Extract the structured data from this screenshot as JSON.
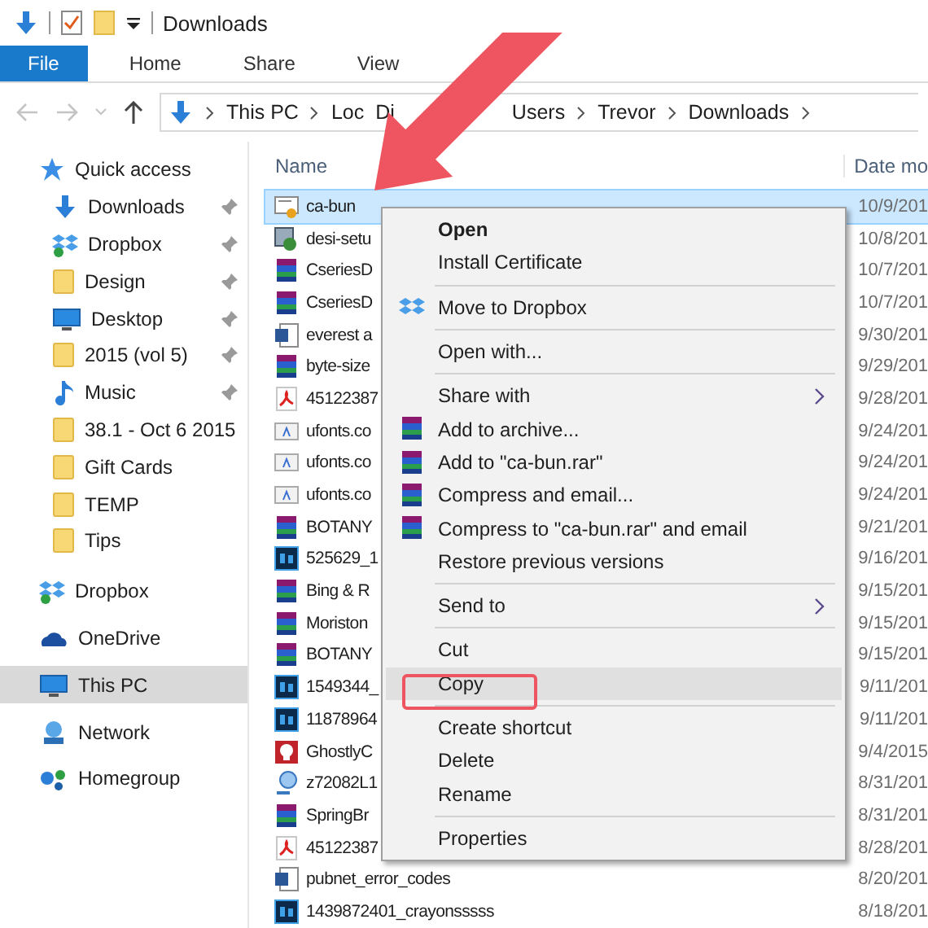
{
  "window": {
    "title": "Downloads"
  },
  "ribbon_tabs": [
    {
      "label": "File",
      "kind": "file",
      "selected": false
    },
    {
      "label": "Home",
      "kind": "tab",
      "selected": false
    },
    {
      "label": "Share",
      "kind": "tab",
      "selected": false
    },
    {
      "label": "View",
      "kind": "tab",
      "selected": false
    }
  ],
  "address": {
    "crumbs": [
      {
        "kind": "crumb",
        "label": "This PC"
      },
      {
        "kind": "partial",
        "parts": [
          "Loc",
          "Di"
        ]
      },
      {
        "kind": "crumb",
        "label": "Users"
      },
      {
        "kind": "crumb",
        "label": "Trevor"
      },
      {
        "kind": "crumb",
        "label": "Downloads"
      }
    ]
  },
  "sidebar": {
    "items": [
      {
        "label": "Quick access",
        "kind": "star",
        "pinned": false,
        "selected": false,
        "children": [
          {
            "label": "Downloads",
            "kind": "download",
            "pinned": true,
            "selected": false
          },
          {
            "label": "Dropbox",
            "kind": "dropbox",
            "pinned": true,
            "selected": false
          },
          {
            "label": "Design",
            "kind": "folder",
            "pinned": true,
            "selected": false
          },
          {
            "label": "Desktop",
            "kind": "desktop",
            "pinned": true,
            "selected": false
          },
          {
            "label": "2015 (vol 5)",
            "kind": "folder",
            "pinned": true,
            "selected": false
          },
          {
            "label": "Music",
            "kind": "music",
            "pinned": true,
            "selected": false
          },
          {
            "label": "38.1 - Oct 6 2015",
            "kind": "folder",
            "pinned": false,
            "selected": false
          },
          {
            "label": "Gift Cards",
            "kind": "folder",
            "pinned": false,
            "selected": false
          },
          {
            "label": "TEMP",
            "kind": "folder",
            "pinned": false,
            "selected": false
          },
          {
            "label": "Tips",
            "kind": "folder",
            "pinned": false,
            "selected": false
          }
        ]
      },
      {
        "label": "Dropbox",
        "kind": "dropbox",
        "pinned": false,
        "selected": false
      },
      {
        "label": "OneDrive",
        "kind": "cloud",
        "pinned": false,
        "selected": false
      },
      {
        "label": "This PC",
        "kind": "desktop",
        "pinned": false,
        "selected": true
      },
      {
        "label": "Network",
        "kind": "network",
        "pinned": false,
        "selected": false
      },
      {
        "label": "Homegroup",
        "kind": "homegroup",
        "pinned": false,
        "selected": false
      }
    ]
  },
  "file_list": {
    "columns": [
      "Name",
      "Date mo"
    ],
    "rows": [
      {
        "name": "ca-bun",
        "date": "10/9/201",
        "kind": "cert",
        "selected": true
      },
      {
        "name": "desi-setu",
        "date": "10/8/201",
        "kind": "setup",
        "selected": false
      },
      {
        "name": "CseriesD",
        "date": "10/7/201",
        "kind": "archive",
        "selected": false
      },
      {
        "name": "CseriesD",
        "date": "10/7/201",
        "kind": "archive",
        "selected": false
      },
      {
        "name": "everest a",
        "date": "9/30/201",
        "kind": "word",
        "selected": false
      },
      {
        "name": "byte-size",
        "date": "9/29/201",
        "kind": "archive",
        "selected": false
      },
      {
        "name": "45122387",
        "date": "9/28/201",
        "kind": "pdf",
        "selected": false
      },
      {
        "name": "ufonts.co",
        "date": "9/24/201",
        "kind": "font",
        "selected": false
      },
      {
        "name": "ufonts.co",
        "date": "9/24/201",
        "kind": "font",
        "selected": false
      },
      {
        "name": "ufonts.co",
        "date": "9/24/201",
        "kind": "font",
        "selected": false
      },
      {
        "name": "BOTANY",
        "date": "9/21/201",
        "kind": "archive",
        "selected": false
      },
      {
        "name": "525629_1",
        "date": "9/16/201",
        "kind": "ps",
        "selected": false
      },
      {
        "name": "Bing & R",
        "date": "9/15/201",
        "kind": "archive",
        "selected": false
      },
      {
        "name": "Moriston",
        "date": "9/15/201",
        "kind": "archive",
        "selected": false
      },
      {
        "name": "BOTANY",
        "date": "9/15/201",
        "kind": "archive",
        "selected": false
      },
      {
        "name": "1549344_",
        "date": "9/11/201",
        "kind": "ps",
        "selected": false
      },
      {
        "name": "11878964",
        "date": "9/11/201",
        "kind": "ps",
        "selected": false
      },
      {
        "name": "GhostlyC",
        "date": "9/4/2015",
        "kind": "app",
        "selected": false
      },
      {
        "name": "z72082L1",
        "date": "8/31/201",
        "kind": "link",
        "selected": false
      },
      {
        "name": "SpringBr",
        "date": "8/31/201",
        "kind": "archive",
        "selected": false
      },
      {
        "name": "45122387",
        "date": "8/28/201",
        "kind": "pdf",
        "selected": false
      },
      {
        "name": "pubnet_error_codes",
        "date": "8/20/201",
        "kind": "word",
        "selected": false
      },
      {
        "name": "1439872401_crayonsssss",
        "date": "8/18/201",
        "kind": "ps",
        "selected": false
      }
    ]
  },
  "context_menu": {
    "items": [
      {
        "label": "Open",
        "kind": "default",
        "selected": false
      },
      {
        "label": "Install Certificate",
        "kind": "plain",
        "selected": false
      },
      {
        "kind": "separator"
      },
      {
        "label": "Move to Dropbox",
        "kind": "dropbox",
        "selected": false
      },
      {
        "kind": "separator"
      },
      {
        "label": "Open with...",
        "kind": "plain",
        "selected": false
      },
      {
        "kind": "separator"
      },
      {
        "label": "Share with",
        "kind": "submenu",
        "selected": false
      },
      {
        "label": "Add to archive...",
        "kind": "archive",
        "selected": false
      },
      {
        "label": "Add to \"ca-bun.rar\"",
        "kind": "archive",
        "selected": false
      },
      {
        "label": "Compress and email...",
        "kind": "archive",
        "selected": false
      },
      {
        "label": "Compress to \"ca-bun.rar\" and email",
        "kind": "archive",
        "selected": false
      },
      {
        "label": "Restore previous versions",
        "kind": "plain",
        "selected": false
      },
      {
        "kind": "separator"
      },
      {
        "label": "Send to",
        "kind": "submenu",
        "selected": false
      },
      {
        "kind": "separator"
      },
      {
        "label": "Cut",
        "kind": "plain",
        "selected": false
      },
      {
        "label": "Copy",
        "kind": "plain",
        "selected": true
      },
      {
        "kind": "separator"
      },
      {
        "label": "Create shortcut",
        "kind": "plain",
        "selected": false
      },
      {
        "label": "Delete",
        "kind": "plain",
        "selected": false
      },
      {
        "label": "Rename",
        "kind": "plain",
        "selected": false
      },
      {
        "kind": "separator"
      },
      {
        "label": "Properties",
        "kind": "plain",
        "selected": false
      }
    ]
  }
}
